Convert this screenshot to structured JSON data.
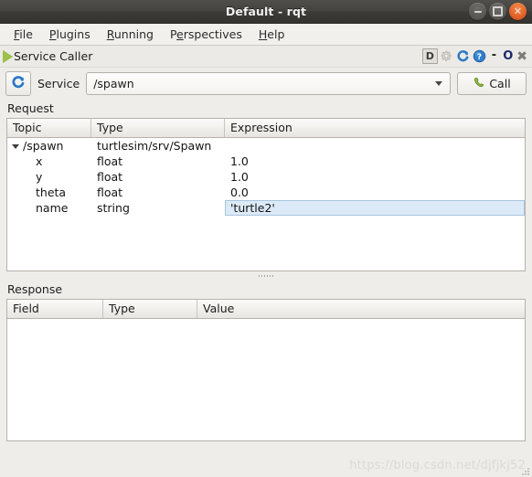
{
  "window": {
    "title": "Default - rqt",
    "buttons": [
      {
        "name": "minimize",
        "glyph": "−"
      },
      {
        "name": "maximize",
        "glyph": "□"
      },
      {
        "name": "close",
        "glyph": "✕"
      }
    ]
  },
  "menubar": {
    "items": [
      {
        "mnemonic": "F",
        "rest": "ile"
      },
      {
        "mnemonic": "P",
        "rest": "lugins"
      },
      {
        "mnemonic": "R",
        "rest": "unning"
      },
      {
        "pre": "P",
        "mnemonic": "e",
        "rest": "rspectives"
      },
      {
        "mnemonic": "H",
        "rest": "elp"
      }
    ]
  },
  "plugin": {
    "title": "Service Caller",
    "play_icon": "play-icon",
    "dock_label": "D",
    "gear_icon": "gear-icon",
    "reload_icon": "reload-icon",
    "help_icon": "help-icon",
    "minimize_label": "-",
    "float_label": "O",
    "close_label": "✖"
  },
  "service_row": {
    "refresh_icon": "refresh-icon",
    "label": "Service",
    "value": "/spawn",
    "placeholder": "/spawn",
    "call_label": "Call",
    "call_icon": "phone-icon"
  },
  "request": {
    "section_label": "Request",
    "columns": [
      "Topic",
      "Type",
      "Expression"
    ],
    "rows": [
      {
        "topic": "/spawn",
        "type": "turtlesim/srv/Spawn",
        "expression": "",
        "expandable": true,
        "expanded": true,
        "level": 0,
        "selected": false
      },
      {
        "topic": "x",
        "type": "float",
        "expression": "1.0",
        "expandable": false,
        "level": 1,
        "selected": false
      },
      {
        "topic": "y",
        "type": "float",
        "expression": "1.0",
        "expandable": false,
        "level": 1,
        "selected": false
      },
      {
        "topic": "theta",
        "type": "float",
        "expression": "0.0",
        "expandable": false,
        "level": 1,
        "selected": false
      },
      {
        "topic": "name",
        "type": "string",
        "expression": "'turtle2'",
        "expandable": false,
        "level": 1,
        "selected": true
      }
    ]
  },
  "response": {
    "section_label": "Response",
    "columns": [
      "Field",
      "Type",
      "Value"
    ],
    "rows": []
  },
  "watermark": "https://blog.csdn.net/djfjkj52",
  "colors": {
    "accent_blue": "#2a6ebb",
    "selection_bg": "#dceaf7",
    "selection_border": "#a8c4dd",
    "window_chrome": "#3c3b38",
    "close_button": "#e4652a",
    "panel_bg": "#efedea",
    "green_icon": "#8cba3f"
  }
}
